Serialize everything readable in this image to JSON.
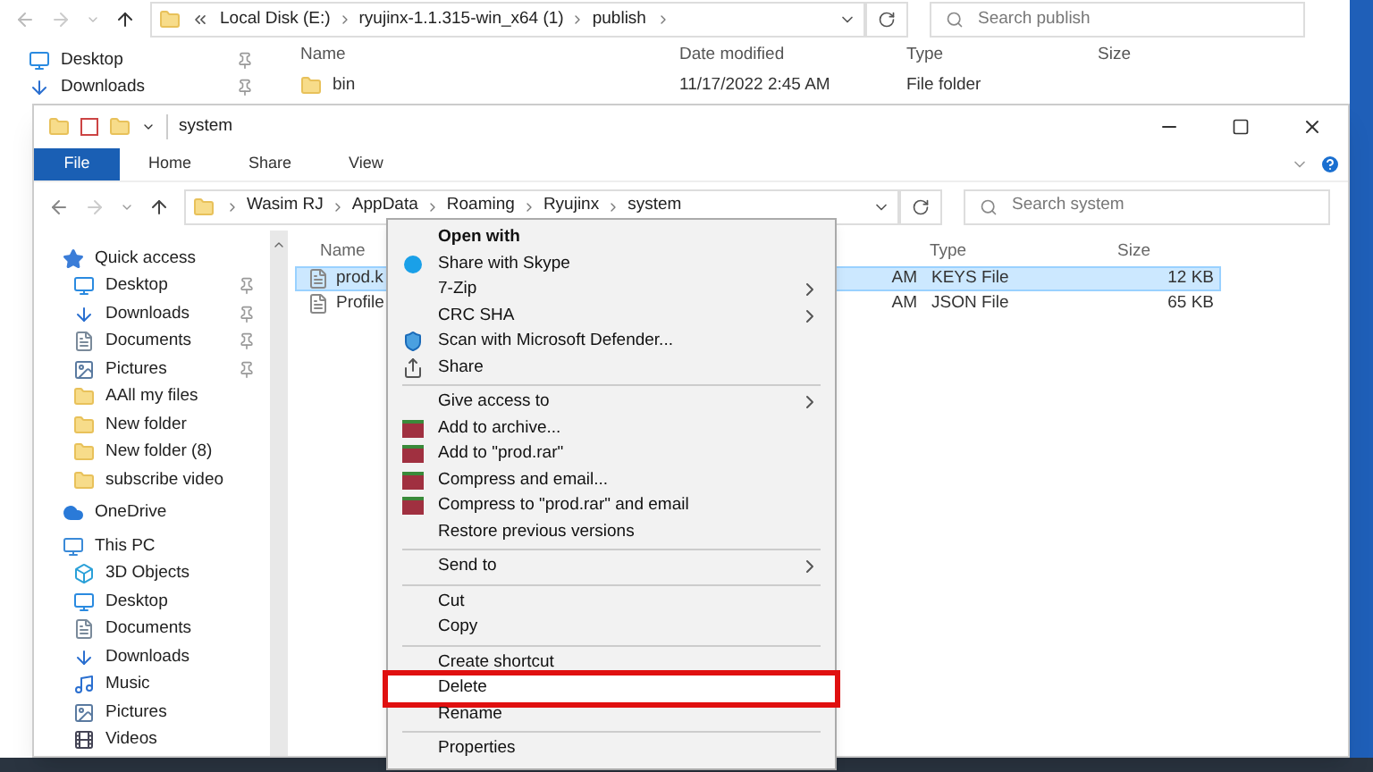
{
  "back_window": {
    "address": [
      "Local Disk (E:)",
      "ryujinx-1.1.315-win_x64 (1)",
      "publish"
    ],
    "search": {
      "placeholder": "Search publish"
    },
    "nav": [
      {
        "label": "Desktop",
        "kind": "desktop",
        "pinned": true
      },
      {
        "label": "Downloads",
        "kind": "download",
        "pinned": true
      }
    ],
    "columns": [
      "Name",
      "Date modified",
      "Type",
      "Size"
    ],
    "rows": [
      {
        "name": "bin",
        "date": "11/17/2022 2:45 AM",
        "type": "File folder"
      }
    ]
  },
  "window": {
    "title": "system",
    "ribbon_tabs": [
      {
        "label": "File",
        "selected": true
      },
      {
        "label": "Home",
        "selected": false
      },
      {
        "label": "Share",
        "selected": false
      },
      {
        "label": "View",
        "selected": false
      }
    ],
    "address": [
      "Wasim RJ",
      "AppData",
      "Roaming",
      "Ryujinx",
      "system"
    ],
    "search": {
      "placeholder": "Search system"
    },
    "nav": [
      {
        "label": "Quick access",
        "kind": "star",
        "children": [
          {
            "label": "Desktop",
            "kind": "desktop",
            "pinned": true
          },
          {
            "label": "Downloads",
            "kind": "download",
            "pinned": true
          },
          {
            "label": "Documents",
            "kind": "document",
            "pinned": true
          },
          {
            "label": "Pictures",
            "kind": "picture",
            "pinned": true
          },
          {
            "label": "AAll my files",
            "kind": "folder",
            "pinned": false
          },
          {
            "label": "New folder",
            "kind": "folder",
            "pinned": false
          },
          {
            "label": "New folder (8)",
            "kind": "folder",
            "pinned": false
          },
          {
            "label": "subscribe video",
            "kind": "folder",
            "pinned": false
          }
        ]
      },
      {
        "label": "OneDrive",
        "kind": "cloud"
      },
      {
        "label": "This PC",
        "kind": "pc",
        "children": [
          {
            "label": "3D Objects",
            "kind": "cube",
            "pinned": false
          },
          {
            "label": "Desktop",
            "kind": "desktop",
            "pinned": false
          },
          {
            "label": "Documents",
            "kind": "document",
            "pinned": false
          },
          {
            "label": "Downloads",
            "kind": "download",
            "pinned": false
          },
          {
            "label": "Music",
            "kind": "music",
            "pinned": false
          },
          {
            "label": "Pictures",
            "kind": "picture",
            "pinned": false
          },
          {
            "label": "Videos",
            "kind": "video",
            "pinned": false
          }
        ]
      }
    ],
    "columns": [
      "Name",
      "Type",
      "Size"
    ],
    "rows": [
      {
        "name": "prod.k",
        "date": "AM",
        "type": "KEYS File",
        "size": "12 KB",
        "selected": true
      },
      {
        "name": "Profile",
        "date": "AM",
        "type": "JSON File",
        "size": "65 KB",
        "selected": false
      }
    ]
  },
  "context_menu": {
    "groups": [
      [
        {
          "label": "Open with",
          "kind": "plain",
          "default": true,
          "submenu": false,
          "highlighted": false
        },
        {
          "label": "Share with Skype",
          "kind": "round",
          "default": false,
          "submenu": false,
          "highlighted": false
        },
        {
          "label": "7-Zip",
          "kind": "plain",
          "default": false,
          "submenu": true,
          "highlighted": false
        },
        {
          "label": "CRC SHA",
          "kind": "plain",
          "default": false,
          "submenu": true,
          "highlighted": false
        },
        {
          "label": "Scan with Microsoft Defender...",
          "kind": "shield",
          "default": false,
          "submenu": false,
          "highlighted": false
        },
        {
          "label": "Share",
          "kind": "share",
          "default": false,
          "submenu": false,
          "highlighted": false
        }
      ],
      [
        {
          "label": "Give access to",
          "kind": "plain",
          "default": false,
          "submenu": true,
          "highlighted": false
        },
        {
          "label": "Add to archive...",
          "kind": "archive",
          "default": false,
          "submenu": false,
          "highlighted": false
        },
        {
          "label": "Add to \"prod.rar\"",
          "kind": "archive",
          "default": false,
          "submenu": false,
          "highlighted": false
        },
        {
          "label": "Compress and email...",
          "kind": "archive",
          "default": false,
          "submenu": false,
          "highlighted": false
        },
        {
          "label": "Compress to \"prod.rar\" and email",
          "kind": "archive",
          "default": false,
          "submenu": false,
          "highlighted": false
        },
        {
          "label": "Restore previous versions",
          "kind": "plain",
          "default": false,
          "submenu": false,
          "highlighted": false
        }
      ],
      [
        {
          "label": "Send to",
          "kind": "plain",
          "default": false,
          "submenu": true,
          "highlighted": false
        }
      ],
      [
        {
          "label": "Cut",
          "kind": "plain",
          "default": false,
          "submenu": false,
          "highlighted": false
        },
        {
          "label": "Copy",
          "kind": "plain",
          "default": false,
          "submenu": false,
          "highlighted": false
        }
      ],
      [
        {
          "label": "Create shortcut",
          "kind": "plain",
          "default": false,
          "submenu": false,
          "highlighted": false
        },
        {
          "label": "Delete",
          "kind": "plain",
          "default": false,
          "submenu": false,
          "highlighted": true
        },
        {
          "label": "Rename",
          "kind": "plain",
          "default": false,
          "submenu": false,
          "highlighted": false
        }
      ],
      [
        {
          "label": "Properties",
          "kind": "plain",
          "default": false,
          "submenu": false,
          "highlighted": false
        }
      ]
    ]
  }
}
